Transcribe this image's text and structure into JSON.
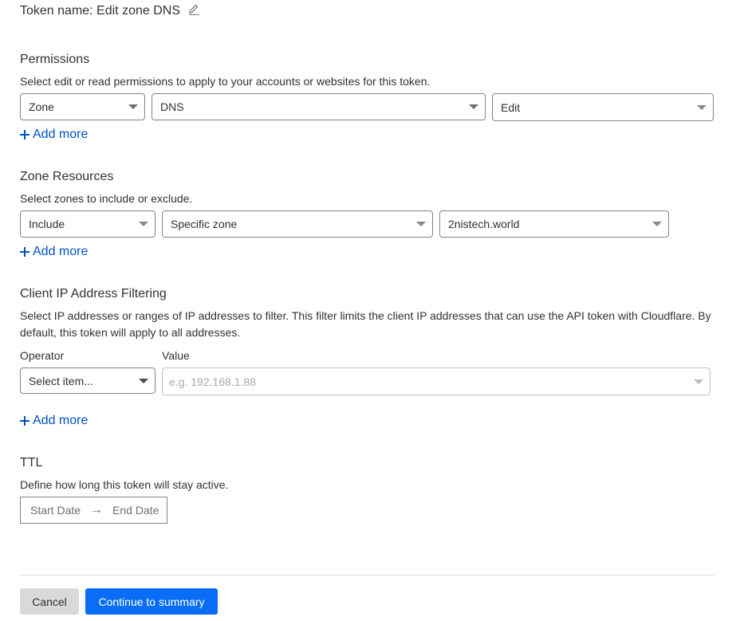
{
  "token": {
    "label": "Token name: Edit zone DNS",
    "edit_icon": "pencil-icon"
  },
  "permissions": {
    "title": "Permissions",
    "description": "Select edit or read permissions to apply to your accounts or websites for this token.",
    "selects": [
      {
        "value": "Zone"
      },
      {
        "value": "DNS"
      },
      {
        "value": "Edit"
      }
    ],
    "add_more": "Add more"
  },
  "zone_resources": {
    "title": "Zone Resources",
    "description": "Select zones to include or exclude.",
    "selects": [
      {
        "value": "Include"
      },
      {
        "value": "Specific zone"
      },
      {
        "value": "2nistech.world"
      }
    ],
    "add_more": "Add more"
  },
  "ip_filtering": {
    "title": "Client IP Address Filtering",
    "description": "Select IP addresses or ranges of IP addresses to filter. This filter limits the client IP addresses that can use the API token with Cloudflare. By default, this token will apply to all addresses.",
    "operator_label": "Operator",
    "operator_placeholder": "Select item...",
    "value_label": "Value",
    "value_placeholder": "e.g. 192.168.1.88",
    "add_more": "Add more"
  },
  "ttl": {
    "title": "TTL",
    "description": "Define how long this token will stay active.",
    "start_placeholder": "Start Date",
    "arrow": "→",
    "end_placeholder": "End Date"
  },
  "footer": {
    "cancel_label": "Cancel",
    "continue_label": "Continue to summary"
  },
  "colors": {
    "link": "#0051c3",
    "primary_button": "#0a6df5",
    "cancel_button": "#d9d9d9"
  }
}
